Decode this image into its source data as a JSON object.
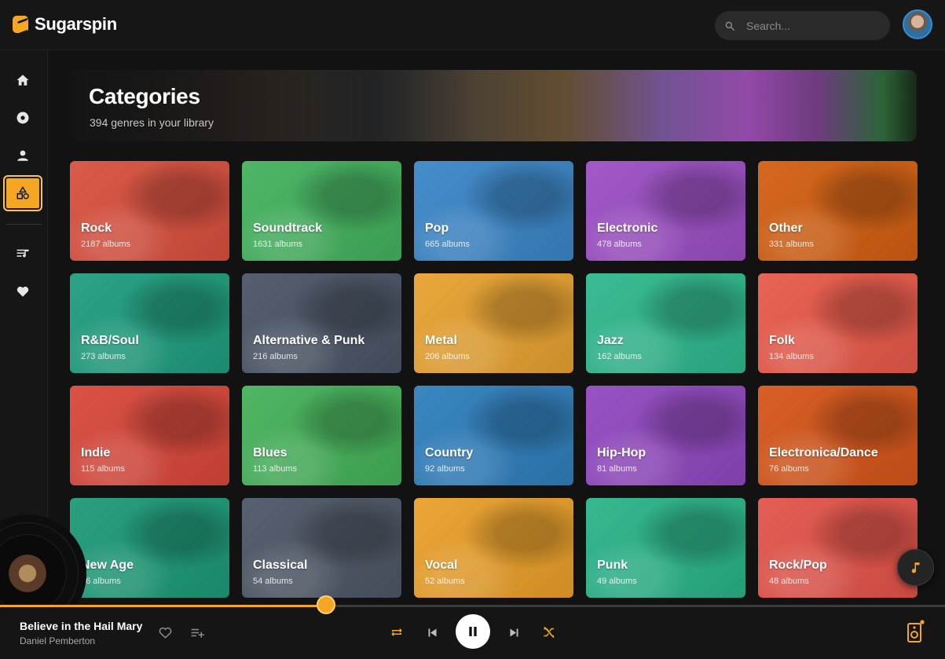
{
  "app": {
    "name": "Sugarspin",
    "accent": "#f5a623"
  },
  "search": {
    "placeholder": "Search..."
  },
  "sidebar": {
    "items": [
      {
        "name": "home-icon"
      },
      {
        "name": "disc-icon"
      },
      {
        "name": "artist-icon"
      },
      {
        "name": "categories-icon",
        "active": true
      },
      {
        "name": "playlist-icon"
      },
      {
        "name": "heart-icon"
      }
    ]
  },
  "hero": {
    "title": "Categories",
    "subtitle": "394 genres in your library"
  },
  "categories": [
    {
      "name": "Rock",
      "count": "2187 albums",
      "color": "#d9503e"
    },
    {
      "name": "Soundtrack",
      "count": "1631 albums",
      "color": "#43b25e"
    },
    {
      "name": "Pop",
      "count": "665 albums",
      "color": "#3a86c8"
    },
    {
      "name": "Electronic",
      "count": "478 albums",
      "color": "#9c4fc4"
    },
    {
      "name": "Other",
      "count": "331 albums",
      "color": "#d35f12"
    },
    {
      "name": "R&B/Soul",
      "count": "273 albums",
      "color": "#1f9e7e"
    },
    {
      "name": "Alternative & Punk",
      "count": "216 albums",
      "color": "#4a5566"
    },
    {
      "name": "Metal",
      "count": "206 albums",
      "color": "#e8a230"
    },
    {
      "name": "Jazz",
      "count": "162 albums",
      "color": "#2fb88f"
    },
    {
      "name": "Folk",
      "count": "134 albums",
      "color": "#e95a4a"
    },
    {
      "name": "Indie",
      "count": "115 albums",
      "color": "#d9473a"
    },
    {
      "name": "Blues",
      "count": "113 albums",
      "color": "#45b25a"
    },
    {
      "name": "Country",
      "count": "92 albums",
      "color": "#2f7fbd"
    },
    {
      "name": "Hip-Hop",
      "count": "81 albums",
      "color": "#9148c0"
    },
    {
      "name": "Electronica/Dance",
      "count": "76 albums",
      "color": "#d6561a"
    },
    {
      "name": "New Age",
      "count": "66 albums",
      "color": "#1d9a78"
    },
    {
      "name": "Classical",
      "count": "54 albums",
      "color": "#4d5766"
    },
    {
      "name": "Vocal",
      "count": "52 albums",
      "color": "#eba02a"
    },
    {
      "name": "Punk",
      "count": "49 albums",
      "color": "#2ab48a"
    },
    {
      "name": "Rock/Pop",
      "count": "48 albums",
      "color": "#e4544a"
    }
  ],
  "player": {
    "title": "Believe in the Hail Mary",
    "artist": "Daniel Pemberton",
    "progress": 0.345
  }
}
